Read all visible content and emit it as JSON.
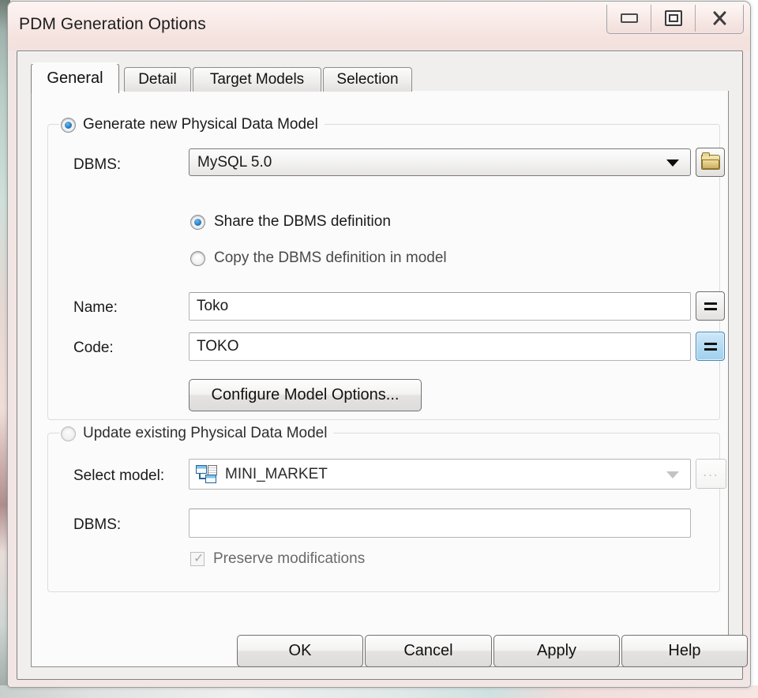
{
  "window": {
    "title": "PDM Generation Options",
    "controls": [
      {
        "name": "minimize",
        "label": "Minimize"
      },
      {
        "name": "restore",
        "label": "Restore"
      },
      {
        "name": "close",
        "label": "Close"
      }
    ]
  },
  "tabs": [
    {
      "label": "General",
      "active": true
    },
    {
      "label": "Detail",
      "active": false
    },
    {
      "label": "Target Models",
      "active": false
    },
    {
      "label": "Selection",
      "active": false
    }
  ],
  "generate_group": {
    "legend": "Generate new Physical Data Model",
    "selected": true,
    "dbms_label": "DBMS:",
    "dbms_value": "MySQL 5.0",
    "browse_icon": "folder-icon",
    "definition_options": [
      {
        "label": "Share the DBMS definition",
        "selected": true
      },
      {
        "label": "Copy the DBMS definition in model",
        "selected": false
      }
    ],
    "name_label": "Name:",
    "name_value": "Toko",
    "code_label": "Code:",
    "code_value": "TOKO",
    "equals_icon": "equals-icon",
    "configure_button": "Configure Model Options..."
  },
  "update_group": {
    "legend": "Update existing Physical Data Model",
    "selected": false,
    "select_model_label": "Select model:",
    "select_model_value": "MINI_MARKET",
    "model_icon": "physical-data-model-icon",
    "ellipsis_label": "...",
    "dbms_label": "DBMS:",
    "dbms_value": "",
    "preserve_label": "Preserve modifications",
    "preserve_checked": true,
    "preserve_disabled": true
  },
  "buttons": [
    {
      "label": "OK"
    },
    {
      "label": "Cancel"
    },
    {
      "label": "Apply"
    },
    {
      "label": "Help"
    }
  ],
  "colors": {
    "accent_blue": "#1d7cc4",
    "titlebar": "#f4e2de",
    "client_bg": "#f0efee",
    "tab_page": "#fbfbfb"
  }
}
